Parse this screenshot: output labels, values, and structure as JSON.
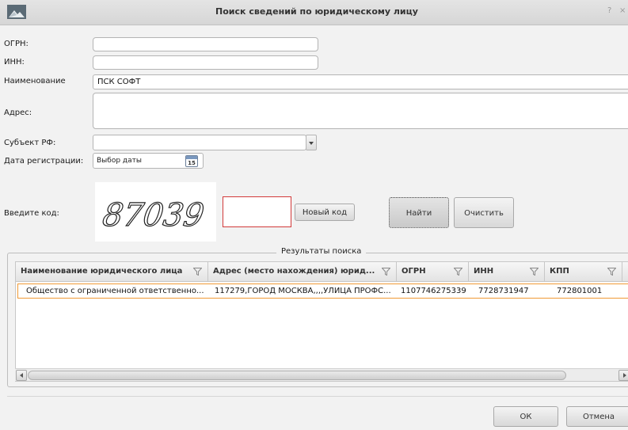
{
  "window": {
    "title": "Поиск сведений по юридическому лицу",
    "help_label": "?",
    "close_label": "×",
    "app_icon": "mountain-landscape-icon"
  },
  "form": {
    "ogrn": {
      "label": "ОГРН:",
      "value": ""
    },
    "inn": {
      "label": "ИНН:",
      "value": ""
    },
    "name": {
      "label": "Наименование",
      "value": "ПСК СОФТ"
    },
    "address": {
      "label": "Адрес:",
      "value": ""
    },
    "subject": {
      "label": "Субъект РФ:",
      "value": ""
    },
    "reg_date": {
      "label": "Дата регистрации:",
      "placeholder": "Выбор даты",
      "calendar_day": "15"
    },
    "captcha": {
      "label": "Введите код:",
      "image_text": "87039",
      "value": ""
    }
  },
  "buttons": {
    "new_code": "Новый код",
    "find": "Найти",
    "clear": "Очистить",
    "ok": "ОК",
    "cancel": "Отмена"
  },
  "results": {
    "group_title": "Результаты поиска",
    "columns": [
      "Наименование юридического лица",
      "Адрес (место нахождения) юрид...",
      "ОГРН",
      "ИНН",
      "КПП"
    ],
    "rows": [
      [
        "Общество с ограниченной ответственно...",
        "117279,ГОРОД МОСКВА,,,,УЛИЦА ПРОФС...",
        "1107746275339",
        "7728731947",
        "772801001"
      ]
    ]
  },
  "colors": {
    "selected_row_border": "#f09a35",
    "captcha_input_border": "#d23a3a"
  }
}
